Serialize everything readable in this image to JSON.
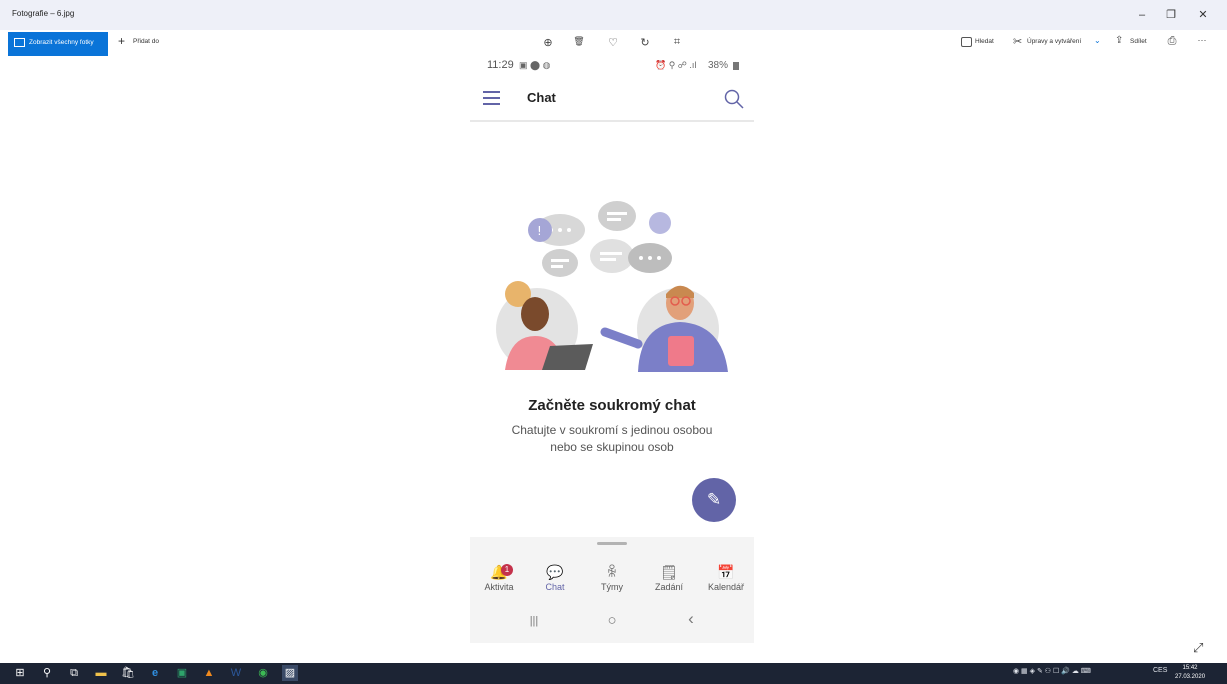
{
  "window": {
    "title": "Fotografie – 6.jpg",
    "minimize_icon": "–",
    "restore_icon": "❐",
    "close_icon": "✕"
  },
  "toolbar": {
    "view_all_label": "Zobrazit všechny fotky",
    "add_to_label": "Přidat do",
    "add_icon": "+",
    "zoom_icon": "⊕",
    "delete_icon": "🗑",
    "favorite_icon": "♡",
    "rotate_icon": "↻",
    "crop_icon": "⌗",
    "search_label": "Hledat",
    "edit_label": "Úpravy a vytváření",
    "edit_chevron": "⌄",
    "share_label": "Sdílet",
    "print_icon": "⎙",
    "more_icon": "···"
  },
  "phone": {
    "status_time": "11:29",
    "status_right": "38%",
    "app_title": "Chat",
    "empty_title": "Začněte soukromý chat",
    "empty_subtitle": "Chatujte v soukromí s jedinou osobou nebo se skupinou osob",
    "compose_icon": "✎",
    "nav": [
      {
        "label": "Aktivita",
        "icon": "🔔"
      },
      {
        "label": "Chat",
        "icon": "💬"
      },
      {
        "label": "Týmy",
        "icon": "ꆜ"
      },
      {
        "label": "Zadání",
        "icon": "🗒"
      },
      {
        "label": "Kalendář",
        "icon": "📅"
      }
    ],
    "activity_badge": "1",
    "system_nav": {
      "recents": "|||",
      "home": "○",
      "back": "‹"
    }
  },
  "taskbar": {
    "language": "CES",
    "clock_time": "15:42",
    "clock_date": "27.03.2020"
  },
  "colors": {
    "accent_blue": "#0a74d8",
    "teams_purple": "#6264a7",
    "badge_red": "#c4314b",
    "taskbar": "#1c2434"
  }
}
